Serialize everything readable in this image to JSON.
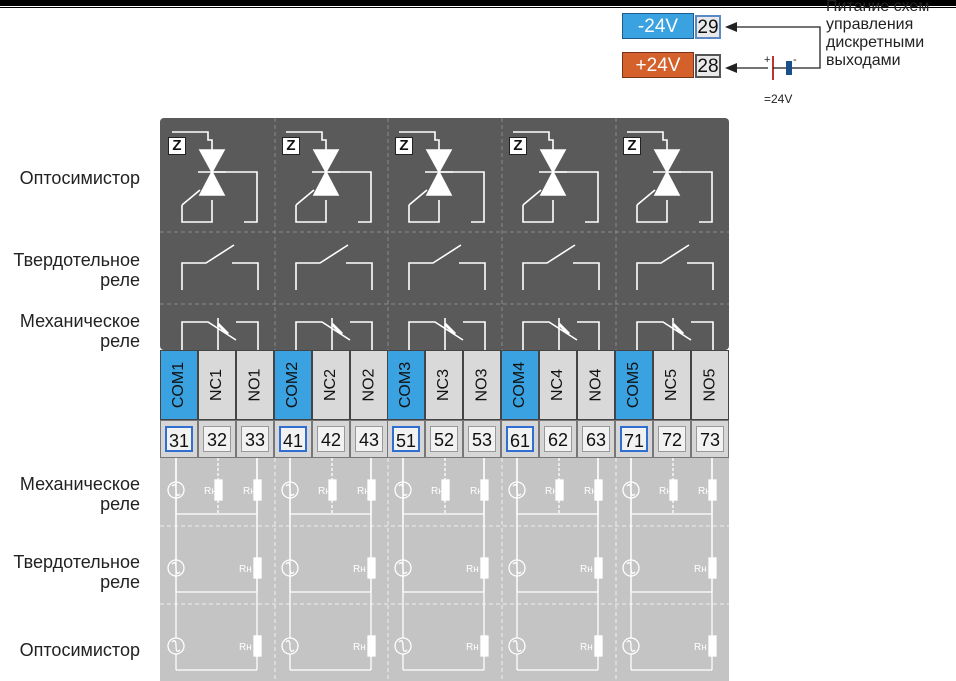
{
  "power": {
    "minus_label": "-24V",
    "minus_terminal": "29",
    "plus_label": "+24V",
    "plus_terminal": "28",
    "battery_label": "=24V",
    "battery_plus": "+",
    "battery_minus": "-",
    "supply_caption_lines": [
      "Питание схем",
      "управления",
      "дискретными",
      "выходами"
    ],
    "minus_color": "#3aa2e0",
    "plus_color": "#d4612c"
  },
  "row_labels": {
    "optosimistor_top": "Оптосимистор",
    "solid_state_top_1": "Твердотельное",
    "solid_state_top_2": "реле",
    "mechanical_top_1": "Механическое",
    "mechanical_top_2": "реле",
    "mechanical_bottom_1": "Механическое",
    "mechanical_bottom_2": "реле",
    "solid_state_bottom_1": "Твердотельное",
    "solid_state_bottom_2": "реле",
    "optosimistor_bottom": "Оптосимистор"
  },
  "zero_cross_symbol": "Z",
  "load_label": "Rн",
  "channels": [
    {
      "com": "COM1",
      "nc": "NC1",
      "no": "NO1",
      "com_num": "31",
      "nc_num": "32",
      "no_num": "33"
    },
    {
      "com": "COM2",
      "nc": "NC2",
      "no": "NO2",
      "com_num": "41",
      "nc_num": "42",
      "no_num": "43"
    },
    {
      "com": "COM3",
      "nc": "NC3",
      "no": "NO3",
      "com_num": "51",
      "nc_num": "52",
      "no_num": "53"
    },
    {
      "com": "COM4",
      "nc": "NC4",
      "no": "NO4",
      "com_num": "61",
      "nc_num": "62",
      "no_num": "63"
    },
    {
      "com": "COM5",
      "nc": "NC5",
      "no": "NO5",
      "com_num": "71",
      "nc_num": "72",
      "no_num": "73"
    }
  ],
  "colors": {
    "com_blue": "#3aa2e0",
    "terminal_grey": "#d9d9d9",
    "top_panel": "#5a5a5a",
    "bottom_panel": "#c4c4c4"
  }
}
